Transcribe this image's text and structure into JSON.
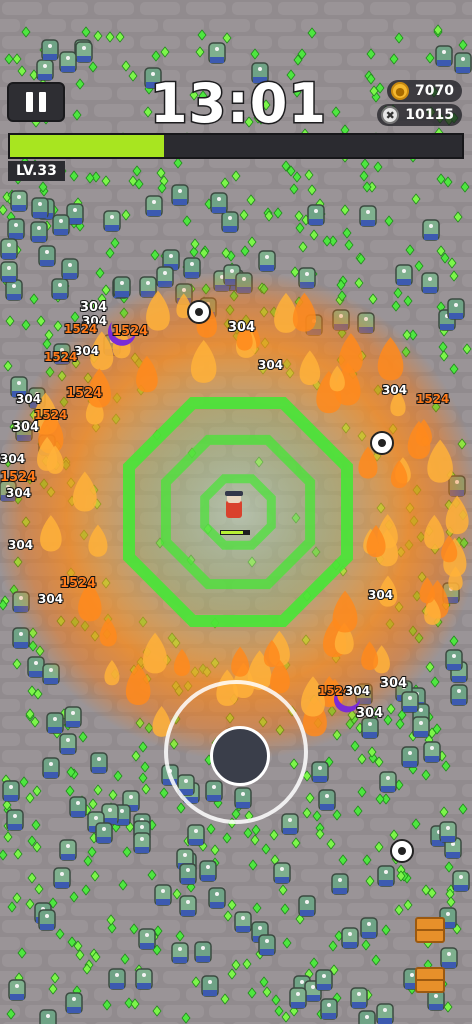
{
  "hud": {
    "timer": "13:01",
    "coins": "7070",
    "kills": "10115",
    "level_label": "LV.33",
    "xp_progress": 0.34
  },
  "icons": {
    "pause": "pause-icon",
    "coin": "coin-icon",
    "kills": "skull-icon"
  },
  "colors": {
    "xp_fill": "#a8e520",
    "ring": "#47e636",
    "fire": "#ff9a1e"
  },
  "damage_numbers": [
    {
      "text": "304"
    },
    {
      "text": "304"
    },
    {
      "text": "1524",
      "crit": true
    },
    {
      "text": "1524",
      "crit": true
    },
    {
      "text": "304"
    },
    {
      "text": "1524",
      "crit": true
    },
    {
      "text": "1524",
      "crit": true
    },
    {
      "text": "304"
    },
    {
      "text": "1524",
      "crit": true
    },
    {
      "text": "304"
    },
    {
      "text": "304"
    },
    {
      "text": "1524",
      "crit": true
    },
    {
      "text": "304"
    },
    {
      "text": "304"
    },
    {
      "text": "304"
    },
    {
      "text": "1524",
      "crit": true
    },
    {
      "text": "304"
    },
    {
      "text": "304"
    },
    {
      "text": "1524",
      "crit": true
    },
    {
      "text": "304"
    },
    {
      "text": "304"
    },
    {
      "text": "304"
    },
    {
      "text": "1524",
      "crit": true
    },
    {
      "text": "304"
    },
    {
      "text": "304"
    }
  ]
}
